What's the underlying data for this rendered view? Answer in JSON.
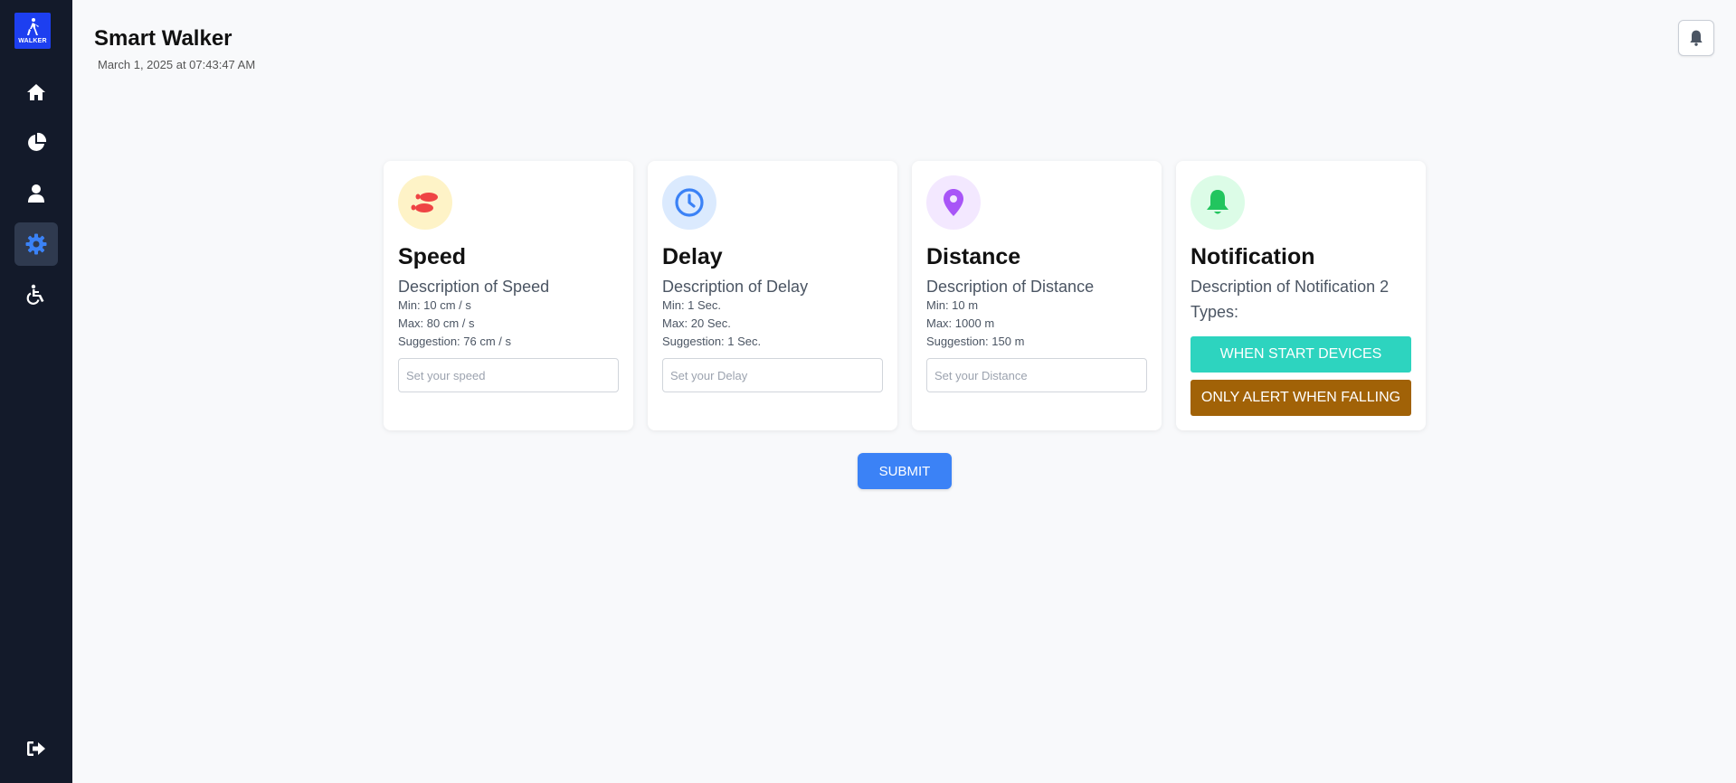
{
  "app": {
    "title": "Smart Walker",
    "date": "March 1, 2025 at 07:43:47 AM",
    "logo_text": "WALKER"
  },
  "sidebar": {
    "items": [
      {
        "icon": "home-icon"
      },
      {
        "icon": "pie-chart-icon"
      },
      {
        "icon": "user-icon"
      },
      {
        "icon": "gear-icon",
        "active": true
      },
      {
        "icon": "wheelchair-icon"
      }
    ],
    "logout_icon": "logout-icon"
  },
  "cards": {
    "speed": {
      "title": "Speed",
      "description": "Description of Speed",
      "min": "Min: 10 cm / s",
      "max": "Max: 80 cm / s",
      "suggestion": "Suggestion: 76 cm / s",
      "placeholder": "Set your speed",
      "icon": "footprints-icon"
    },
    "delay": {
      "title": "Delay",
      "description": "Description of Delay",
      "min": "Min: 1 Sec.",
      "max": "Max: 20 Sec.",
      "suggestion": "Suggestion: 1 Sec.",
      "placeholder": "Set your Delay",
      "icon": "clock-icon"
    },
    "distance": {
      "title": "Distance",
      "description": "Description of Distance",
      "min": "Min: 10 m",
      "max": "Max: 1000 m",
      "suggestion": "Suggestion: 150 m",
      "placeholder": "Set your Distance",
      "icon": "map-pin-icon"
    },
    "notification": {
      "title": "Notification",
      "description": "Description of Notification 2 Types:",
      "option1": "WHEN START DEVICES",
      "option2": "ONLY ALERT WHEN FALLING",
      "icon": "bell-icon"
    }
  },
  "submit_label": "SUBMIT",
  "colors": {
    "sidebar_bg": "#131a2a",
    "accent": "#3b82f6",
    "notif_option1": "#2dd4bf",
    "notif_option2": "#a16207"
  }
}
